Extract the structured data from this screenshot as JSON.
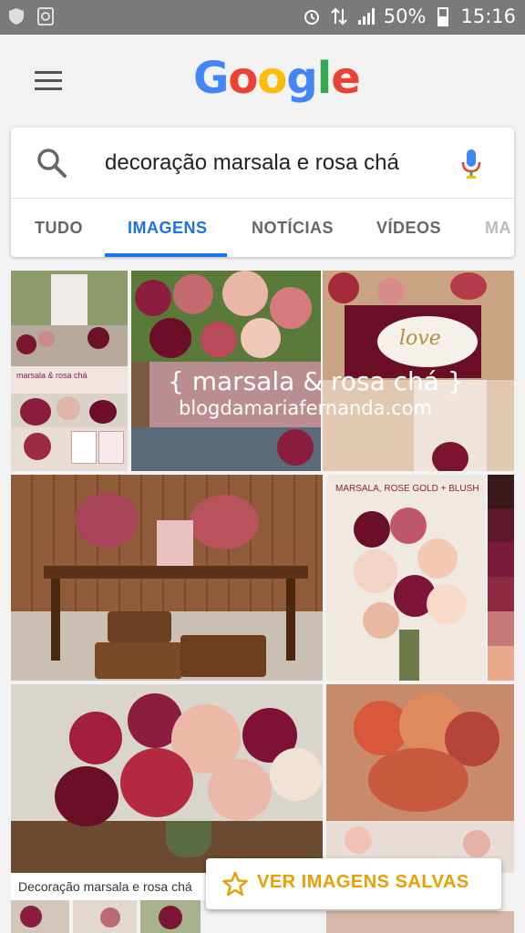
{
  "status_bar": {
    "battery": "50%",
    "time": "15:16"
  },
  "header": {
    "logo_letters": [
      {
        "ch": "G",
        "color": "#4285F4"
      },
      {
        "ch": "o",
        "color": "#EA4335"
      },
      {
        "ch": "o",
        "color": "#FBBC05"
      },
      {
        "ch": "g",
        "color": "#4285F4"
      },
      {
        "ch": "l",
        "color": "#34A853"
      },
      {
        "ch": "e",
        "color": "#EA4335"
      }
    ]
  },
  "search": {
    "query": "decoração marsala e rosa chá"
  },
  "tabs": [
    {
      "label": "TUDO"
    },
    {
      "label": "IMAGENS"
    },
    {
      "label": "NOTÍCIAS"
    },
    {
      "label": "VÍDEOS"
    },
    {
      "label": "MA"
    }
  ],
  "results": {
    "overlay_line1": "{ marsala & rosa chá }",
    "overlay_line2": "blogdamariafernanda.com",
    "love_card": "love",
    "bouquet_banner": "MARSALA, ROSE GOLD + BLUSH",
    "collage_label": "marsala & rosa chá",
    "caption": "Decoração marsala e rosa chá"
  },
  "saved_button": {
    "label": "VER IMAGENS SALVAS"
  },
  "colors": {
    "accent": "#1a73e8",
    "saved": "#e8a000",
    "marsala": "#8b1e3f"
  }
}
